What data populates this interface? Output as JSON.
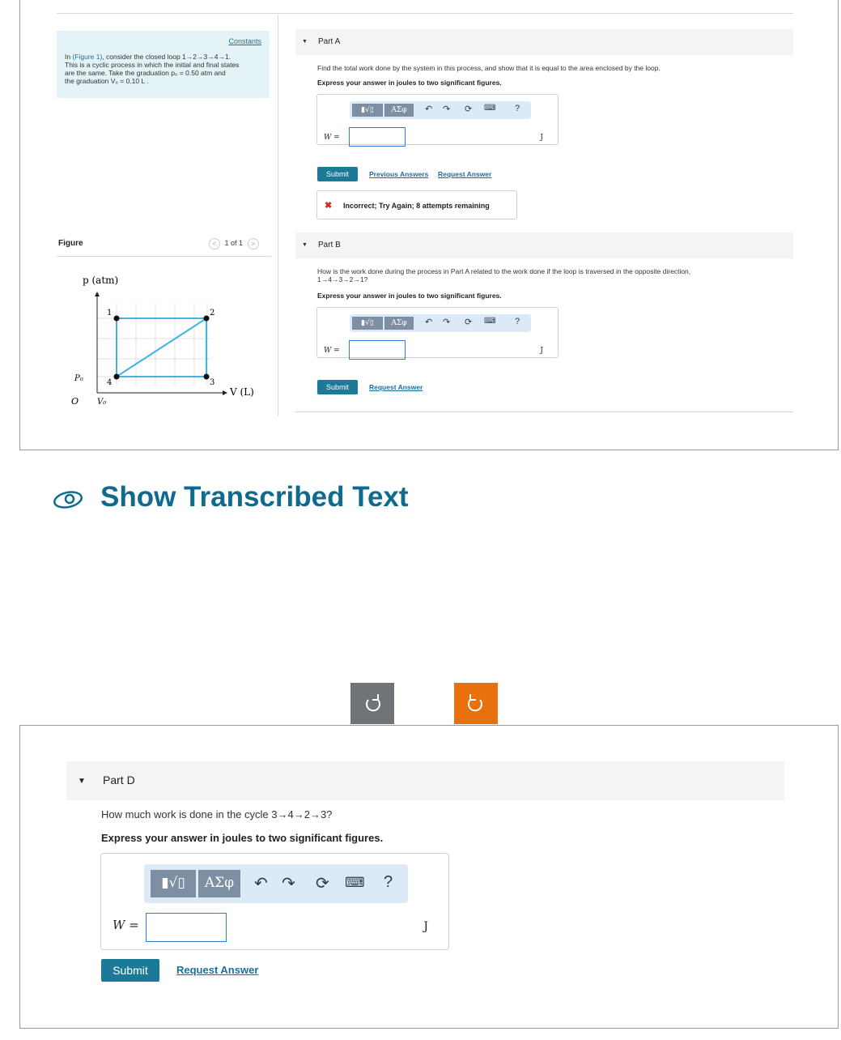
{
  "info": {
    "constants_link": "Constants",
    "text_pre": "In ",
    "figure_link": "(Figure 1)",
    "text_1": ", consider the closed loop 1→2→3→4→1.",
    "text_2": "This is a cyclic process in which the initial and final states",
    "text_3": "are the same. Take the graduation p₀ = 0.50 atm and",
    "text_4": "the graduation V₀ = 0.10 L ."
  },
  "figure": {
    "label": "Figure",
    "nav": "1 of 1",
    "prev": "<",
    "next": ">",
    "y_axis": "p (atm)",
    "x_axis": "V (L)",
    "origin": "O",
    "p0": "P₀",
    "v0": "V₀",
    "points": [
      "1",
      "2",
      "3",
      "4"
    ]
  },
  "toolbar": {
    "templates": "▮√▯",
    "greek": "ΑΣφ",
    "undo": "↶",
    "redo": "↷",
    "reset": "⟳",
    "keyboard": "⌨",
    "help": "?"
  },
  "partA": {
    "title": "Part A",
    "question": "Find the total work done by the system in this process, and show that it is equal to the area enclosed by the loop.",
    "instruction": "Express your answer in joules to two significant figures.",
    "var_label": "W =",
    "input_value": "",
    "unit": "J",
    "submit": "Submit",
    "prev_answers": "Previous Answers",
    "request_answer": "Request Answer",
    "feedback_icon": "✖",
    "feedback": "Incorrect; Try Again; 8 attempts remaining"
  },
  "partB": {
    "title": "Part B",
    "question_1": "How is the work done during the process in Part A related to the work done if the loop is traversed in the opposite direction,",
    "question_2": "1→4→3→2→1?",
    "instruction": "Express your answer in joules to two significant figures.",
    "var_label": "W =",
    "input_value": "",
    "unit": "J",
    "submit": "Submit",
    "request_answer": "Request Answer"
  },
  "show_transcribed": "Show Transcribed Text",
  "partD": {
    "title": "Part D",
    "question": "How much work is done in the cycle 3→4→2→3?",
    "instruction": "Express your answer in joules to two significant figures.",
    "var_label": "W =",
    "input_value": "",
    "unit": "J",
    "submit": "Submit",
    "request_answer": "Request Answer"
  },
  "colors": {
    "accent": "#1c7a99",
    "link": "#1a6fa0",
    "error": "#d62727",
    "loop": "#3fb5e0",
    "orange_button": "#e9700f"
  }
}
